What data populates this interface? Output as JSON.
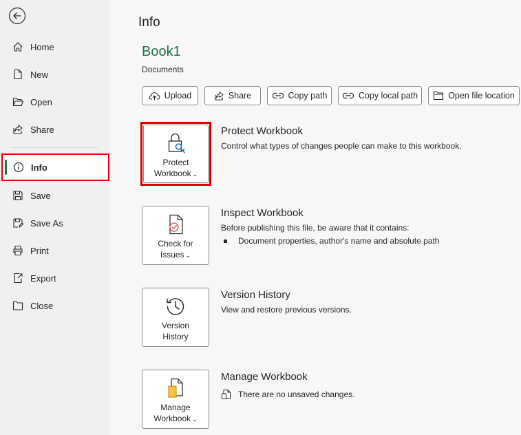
{
  "sidebar": {
    "items": [
      {
        "label": "Home",
        "icon": "home-icon"
      },
      {
        "label": "New",
        "icon": "new-document-icon"
      },
      {
        "label": "Open",
        "icon": "folder-open-icon"
      },
      {
        "label": "Share",
        "icon": "share-icon"
      },
      {
        "label": "Info",
        "icon": "info-icon",
        "active": true
      },
      {
        "label": "Save",
        "icon": "save-icon"
      },
      {
        "label": "Save As",
        "icon": "save-as-icon"
      },
      {
        "label": "Print",
        "icon": "print-icon"
      },
      {
        "label": "Export",
        "icon": "export-icon"
      },
      {
        "label": "Close",
        "icon": "close-folder-icon"
      }
    ]
  },
  "main": {
    "title": "Info",
    "workbook_name": "Book1",
    "workbook_location": "Documents",
    "actions": [
      {
        "label": "Upload",
        "icon": "cloud-upload-icon"
      },
      {
        "label": "Share",
        "icon": "share-icon"
      },
      {
        "label": "Copy path",
        "icon": "link-icon"
      },
      {
        "label": "Copy local path",
        "icon": "link-icon"
      },
      {
        "label": "Open file location",
        "icon": "folder-icon"
      }
    ],
    "sections": [
      {
        "tile_line1": "Protect",
        "tile_line2": "Workbook",
        "title": "Protect Workbook",
        "description": "Control what types of changes people can make to this workbook."
      },
      {
        "tile_line1": "Check for",
        "tile_line2": "Issues",
        "title": "Inspect Workbook",
        "description": "Before publishing this file, be aware that it contains:",
        "bullet": "Document properties, author's name and absolute path"
      },
      {
        "tile_line1": "Version",
        "tile_line2": "History",
        "title": "Version History",
        "description": "View and restore previous versions."
      },
      {
        "tile_line1": "Manage",
        "tile_line2": "Workbook",
        "title": "Manage Workbook",
        "status": "There are no unsaved changes."
      }
    ]
  },
  "colors": {
    "accent_green": "#217346",
    "highlight_red": "#e00000",
    "sidebar_bg": "#f0f0f0"
  }
}
